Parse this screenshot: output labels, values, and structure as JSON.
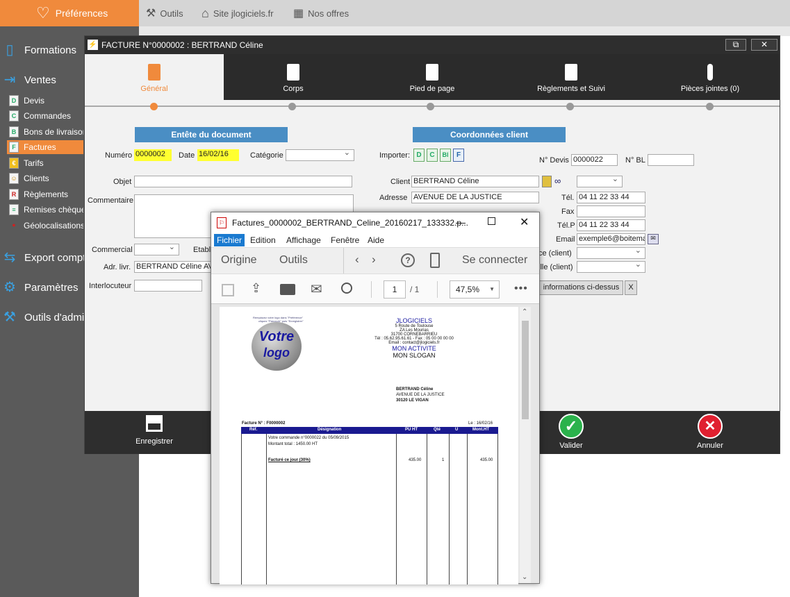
{
  "topbar": {
    "preferences": "Préférences",
    "outils": "Outils",
    "site": "Site jlogiciels.fr",
    "offres": "Nos offres"
  },
  "sidebar": {
    "formations": "Formations",
    "ventes": "Ventes",
    "sub": [
      "Devis",
      "Commandes",
      "Bons de livraison",
      "Factures",
      "Tarifs",
      "Clients",
      "Règlements",
      "Remises chèques",
      "Géolocalisations"
    ],
    "export": "Export compta",
    "parametres": "Paramètres",
    "outils_admin": "Outils d'admin"
  },
  "invoice": {
    "title": "FACTURE N°0000002 : BERTRAND Céline",
    "tabs": [
      "Général",
      "Corps",
      "Pied de page",
      "Règlements et Suivi",
      "Pièces jointes (0)"
    ],
    "entete": "Entête du document",
    "coords": "Coordonnées client",
    "labels": {
      "numero": "Numéro",
      "date": "Date",
      "categorie": "Catégorie",
      "objet": "Objet",
      "commentaire": "Commentaire",
      "commercial": "Commercial",
      "etabl": "Etabl.",
      "adr_livr": "Adr. livr.",
      "interlocuteur": "Interlocuteur",
      "importer": "Importer:",
      "ndevis": "N° Devis",
      "nbl": "N° BL",
      "client": "Client",
      "adresse": "Adresse",
      "tel": "Tél.",
      "fax": "Fax",
      "telp": "Tél.P",
      "email": "Email",
      "ce_client": "ce (client)",
      "ille_client": "ille (client)"
    },
    "values": {
      "numero": "0000002",
      "date": "16/02/16",
      "ndevis": "0000022",
      "client": "BERTRAND Céline",
      "adresse": "AVENUE DE LA JUSTICE",
      "tel": "04 11 22 33 44",
      "telp": "04 11 22 33 44",
      "email": "exemple6@boitemai",
      "adr_livr": "BERTRAND Céline AVE"
    },
    "import_badges": [
      "D",
      "C",
      "Bl",
      "F"
    ],
    "info_btn": "informations ci-dessus",
    "x_btn": "X",
    "footer": {
      "save": "Enregistrer",
      "validate": "Valider",
      "cancel": "Annuler"
    }
  },
  "pdf": {
    "title": "Factures_0000002_BERTRAND_Celine_20160217_133332.p...",
    "menu": [
      "Fichier",
      "Edition",
      "Affichage",
      "Fenêtre",
      "Aide"
    ],
    "toolbar": {
      "origine": "Origine",
      "outils": "Outils",
      "connect": "Se connecter"
    },
    "page_current": "1",
    "page_total": "/ 1",
    "zoom": "47,5%",
    "doc": {
      "logo_small": "Remplacez votre logo dans \"Préférence\"",
      "logo_small2": "cliquez \"Parcourir\" puis \"Enregistrer\"",
      "logo_line1": "Votre",
      "logo_line2": "logo",
      "company": "JLOGICIELS",
      "addr1": "5 Route de Toulouse",
      "addr2": "ZA Les Mourias",
      "addr3": "31700 CORNEBARRIEU",
      "phone": "Tél : 05.62.95.61.61 - Fax : 05 00 00 00 00",
      "email": "Email : contact@jlogiciels.fr",
      "activity": "MON ACTIVITE",
      "slogan": "MON SLOGAN",
      "client1": "BERTRAND Céline",
      "client2": "AVENUE DE LA JUSTICE",
      "client3": "30120 LE VIGAN",
      "facture": "Facture N° : F0000002",
      "le": "Le : 16/02/16",
      "cols": [
        "Réf.",
        "Désignation",
        "PU HT",
        "Qté",
        "U",
        "Mont.HT"
      ],
      "line1": "Votre commande n°0000022 du 05/09/2015",
      "line2": "Montant total : 1450.00 HT",
      "line3": "Facturé ce jour (30%)",
      "pu": "435.00",
      "qte": "1",
      "mont": "435.00"
    }
  },
  "colors": {
    "accent": "#f08a3c",
    "section": "#4a8ec4",
    "dark": "#2e2e2e"
  }
}
